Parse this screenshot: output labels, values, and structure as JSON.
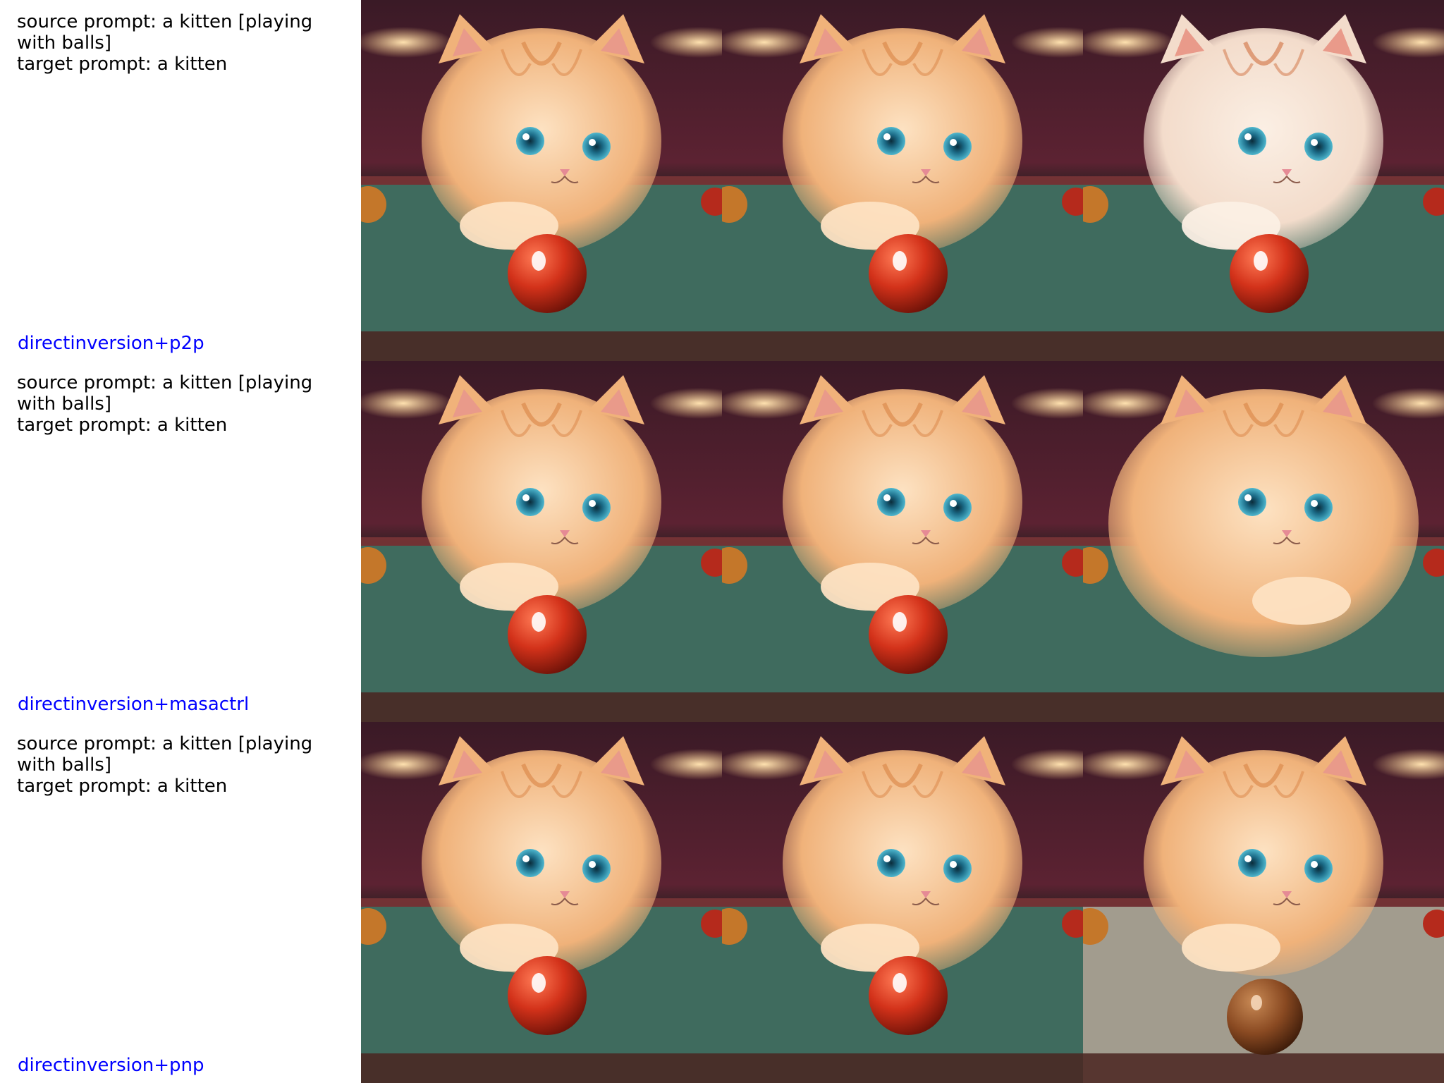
{
  "link_color": "#0000ff",
  "rows": [
    {
      "source_prompt": "source prompt: a kitten [playing with balls]",
      "target_prompt": "target prompt: a kitten",
      "method": "directinversion+p2p",
      "images": [
        {
          "name": "source-image",
          "description": "kitten-with-red-ball"
        },
        {
          "name": "reconstruction-image",
          "description": "kitten-with-red-ball"
        },
        {
          "name": "edited-image",
          "description": "kitten-with-red-ball-pale"
        }
      ]
    },
    {
      "source_prompt": "source prompt: a kitten [playing with balls]",
      "target_prompt": "target prompt: a kitten",
      "method": "directinversion+masactrl",
      "images": [
        {
          "name": "source-image",
          "description": "kitten-with-red-ball"
        },
        {
          "name": "reconstruction-image",
          "description": "kitten-with-red-ball"
        },
        {
          "name": "edited-image",
          "description": "kitten-without-ball"
        }
      ]
    },
    {
      "source_prompt": "source prompt: a kitten [playing with balls]",
      "target_prompt": "target prompt: a kitten",
      "method": "directinversion+pnp",
      "images": [
        {
          "name": "source-image",
          "description": "kitten-with-red-ball"
        },
        {
          "name": "reconstruction-image",
          "description": "kitten-with-red-ball"
        },
        {
          "name": "edited-image",
          "description": "kitten-with-brown-ball"
        }
      ]
    }
  ]
}
